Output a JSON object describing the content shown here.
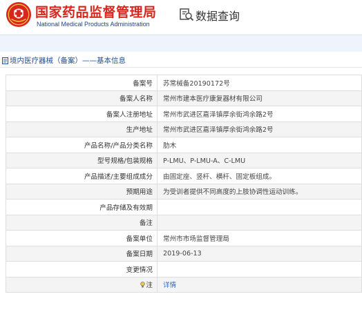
{
  "header": {
    "brand_cn": "国家药品监督管理局",
    "brand_en": "National Medical Products Administration",
    "query_title": "数据查询"
  },
  "breadcrumb": "境内医疗器械（备案）——基本信息",
  "rows": [
    {
      "label": "备案号",
      "value": "苏常械备20190172号"
    },
    {
      "label": "备案人名称",
      "value": "常州市建本医疗康复器材有限公司"
    },
    {
      "label": "备案人注册地址",
      "value": "常州市武进区嘉泽镇厚余街鸿余路2号"
    },
    {
      "label": "生产地址",
      "value": "常州市武进区嘉泽镇厚余街鸿余路2号"
    },
    {
      "label": "产品名称/产品分类名称",
      "value": "肋木"
    },
    {
      "label": "型号规格/包装规格",
      "value": "P-LMU、P-LMU-A、C-LMU"
    },
    {
      "label": "产品描述/主要组成成分",
      "value": "由固定座、竖杆、横杆、固定板组成。"
    },
    {
      "label": "预期用途",
      "value": "为受训者提供不同高度的上肢协调性运动训练。"
    },
    {
      "label": "产品存储及有效期",
      "value": ""
    },
    {
      "label": "备注",
      "value": ""
    },
    {
      "label": "备案单位",
      "value": "常州市市场监督管理局"
    },
    {
      "label": "备案日期",
      "value": "2019-06-13"
    },
    {
      "label": "变更情况",
      "value": ""
    }
  ],
  "note_row": {
    "label": "注",
    "link": "详情"
  },
  "colors": {
    "brand_red": "#d7261d",
    "brand_blue": "#1d3f8c",
    "link_blue": "#2d6ec9"
  },
  "icons": {
    "logo": "nmpa-emblem",
    "query": "data-query-icon",
    "crumb": "document-icon",
    "note": "lightbulb-icon"
  }
}
